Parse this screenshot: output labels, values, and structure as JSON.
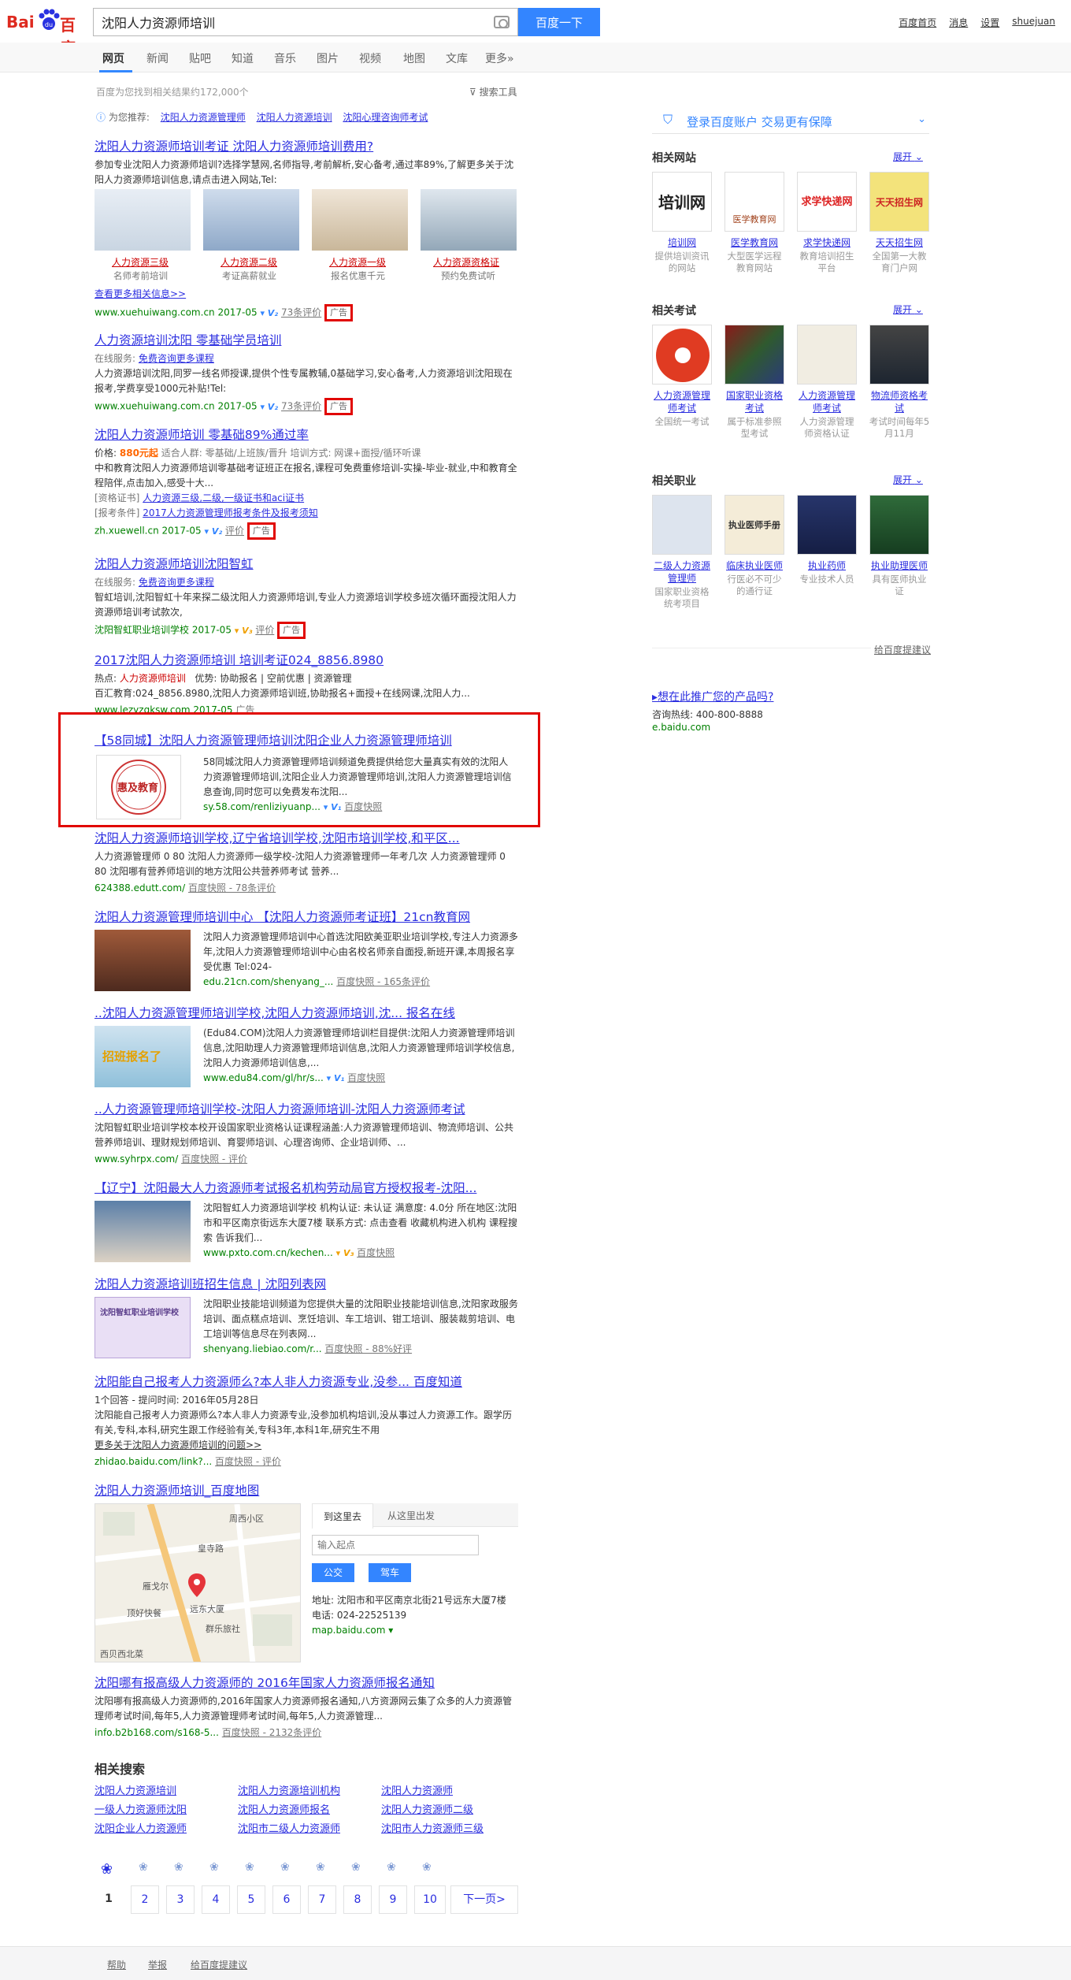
{
  "header": {
    "logo_text": "Bai",
    "logo_text2": "百度",
    "query": "沈阳人力资源师培训",
    "search_btn": "百度一下",
    "links": [
      "百度首页",
      "消息",
      "设置",
      "shuejuan"
    ]
  },
  "tabs": [
    "网页",
    "新闻",
    "贴吧",
    "知道",
    "音乐",
    "图片",
    "视频",
    "地图",
    "文库",
    "更多»"
  ],
  "stats": "百度为您找到相关结果约172,000个",
  "tools": "搜索工具",
  "recommend": {
    "label": "为您推荐:",
    "items": [
      "沈阳人力资源管理师",
      "沈阳人力资源培训",
      "沈阳心理咨询师考试"
    ]
  },
  "results": [
    {
      "title": "沈阳人力资源师培训考证 沈阳人力资源师培训费用?",
      "desc": "参加专业沈阳人力资源师培训?选择学慧网,名师指导,考前解析,安心备考,通过率89%,了解更多关于沈阳人力资源师培训信息,请点击进入网站,Tel:",
      "thumbs": [
        {
          "label": "人力资源三级",
          "sub": "名师考前培训"
        },
        {
          "label": "人力资源二级",
          "sub": "考证高薪就业"
        },
        {
          "label": "人力资源一级",
          "sub": "报名优惠千元"
        },
        {
          "label": "人力资源资格证",
          "sub": "预约免费试听"
        }
      ],
      "more": "查看更多相关信息>>",
      "url": "www.xuehuiwang.com.cn  2017-05",
      "meta": "73条评价",
      "ad": "广告"
    },
    {
      "title": "人力资源培训沈阳 零基础学员培训",
      "service_label": "在线服务:",
      "service": "免费咨询更多课程",
      "desc": "人力资源培训沈阳,同罗一线名师授课,提供个性专属教辅,0基础学习,安心备考,人力资源培训沈阳现在报考,学费享受1000元补贴!Tel:",
      "url": "www.xuehuiwang.com.cn  2017-05",
      "meta": "73条评价",
      "ad": "广告"
    },
    {
      "title": "沈阳人力资源师培训 零基础89%通过率",
      "price_label": "价格:",
      "price": "880元起",
      "info": "适合人群: 零基础/上班族/晋升   培训方式: 网课+面授/循环听课",
      "desc": "中和教育沈阳人力资源师培训零基础考证班正在报名,课程可免费重修培训-实操-毕业-就业,中和教育全程陪伴,点击加入,感受十大...",
      "cert_label": "[资格证书]",
      "cert": "人力资源三级,二级,一级证书和aci证书",
      "cond_label": "[报考条件]",
      "cond": "2017人力资源管理师报考条件及报考须知",
      "url": "zh.xuewell.cn  2017-05",
      "meta": "评价",
      "ad": "广告"
    },
    {
      "title": "沈阳人力资源师培训沈阳智虹",
      "service_label": "在线服务:",
      "service": "免费咨询更多课程",
      "desc": "智虹培训,沈阳智虹十年来探二级沈阳人力资源师培训,专业人力资源培训学校多班次循环面授沈阳人力资源师培训考试款次,",
      "url": "沈阳智虹职业培训学校  2017-05",
      "meta": "评价",
      "ad": "广告"
    },
    {
      "title": "2017沈阳人力资源师培训 培训考证024_8856.8980",
      "hot_label": "热点:",
      "hot": "人力资源师培训",
      "hot2": "优势: 协助报名 | 空前优惠 | 资源管理",
      "desc": "百汇教育:024_8856.8980,沈阳人力资源师培训班,协助报名+面授+在线网课,沈阳人力...",
      "url": "www.lezyzgksw.com  2017-05",
      "meta": "广告"
    },
    {
      "title": "【58同城】沈阳人力资源管理师培训沈阳企业人力资源管理师培训",
      "logo_text": "惠及教育",
      "desc": "58同城沈阳人力资源管理师培训频道免费提供给您大量真实有效的沈阳人力资源管理师培训,沈阳企业人力资源管理师培训,沈阳人力资源管理培训信息查询,同时您可以免费发布沈阳...",
      "url": "sy.58.com/renliziyuanp...",
      "meta": "百度快照"
    },
    {
      "title": "沈阳人力资源师培训学校,辽宁省培训学校,沈阳市培训学校,和平区...",
      "desc": "人力资源管理师 0 80 沈阳人力资源师一级学校-沈阳人力资源管理师一年考几次 人力资源管理师 0 80 沈阳哪有营养师培训的地方沈阳公共营养师考试 营养...",
      "url": "624388.edutt.com/",
      "meta": "百度快照 - 78条评价"
    },
    {
      "title": "沈阳人力资源管理师培训中心 【沈阳人力资源师考证班】21cn教育网",
      "desc": "沈阳人力资源管理师培训中心首选沈阳欧美亚职业培训学校,专注人力资源多年,沈阳人力资源管理师培训中心由名校名师亲自面授,新班开课,本周报名享受优惠 Tel:024-",
      "url": "edu.21cn.com/shenyang_...",
      "meta": "百度快照 - 165条评价"
    },
    {
      "title": "..沈阳人力资源管理师培训学校,沈阳人力资源师培训,沈... 报名在线",
      "img_text": "招班报名了",
      "desc": "(Edu84.COM)沈阳人力资源管理师培训栏目提供:沈阳人力资源管理师培训信息,沈阳助理人力资源管理师培训信息,沈阳人力资源管理师培训学校信息,沈阳人力资源师培训信息,...",
      "url": "www.edu84.com/gl/hr/s...",
      "meta": "百度快照"
    },
    {
      "title": "..人力资源管理师培训学校-沈阳人力资源师培训-沈阳人力资源师考试",
      "desc": "沈阳智虹职业培训学校本校开设国家职业资格认证课程涵盖:人力资源管理师培训、物流师培训、公共营养师培训、理财规划师培训、育婴师培训、心理咨询师、企业培训师、...",
      "url": "www.syhrpx.com/",
      "meta": "百度快照 - 评价"
    },
    {
      "title": "【辽宁】沈阳最大人力资源师考试报名机构劳动局官方授权报考-沈阳...",
      "desc": "沈阳智虹人力资源培训学校 机构认证: 未认证 满意度: 4.0分 所在地区:沈阳市和平区南京街远东大厦7楼 联系方式: 点击查看 收藏机构进入机构 课程搜索 告诉我们...",
      "url": "www.pxto.com.cn/kechen...",
      "meta": "百度快照"
    },
    {
      "title": "沈阳人力资源培训班招生信息 | 沈阳列表网",
      "img_text": "沈阳智虹职业培训学校",
      "desc": "沈阳职业技能培训频道为您提供大量的沈阳职业技能培训信息,沈阳家政服务培训、面点糕点培训、烹饪培训、车工培训、钳工培训、服装裁剪培训、电工培训等信息尽在列表网...",
      "url": "shenyang.liebiao.com/r...",
      "meta": "百度快照 - 88%好评"
    },
    {
      "title": "沈阳能自己报考人力资源师么?本人非人力资源专业,没参... 百度知道",
      "answers": "1个回答 - 提问时间: 2016年05月28日",
      "desc": "沈阳能自己报考人力资源师么?本人非人力资源专业,没参加机构培训,没从事过人力资源工作。跟学历有关,专科,本科,研究生跟工作经验有关,专科3年,本科1年,研究生不用",
      "more": "更多关于沈阳人力资源师培训的问题>>",
      "url": "zhidao.baidu.com/link?...",
      "meta": "百度快照 - 评价"
    },
    {
      "title": "沈阳人力资源师培训_百度地图",
      "map_tabs": [
        "到这里去",
        "从这里出发"
      ],
      "input_placeholder": "输入起点",
      "btn_bus": "公交",
      "btn_drive": "驾车",
      "addr_label": "地址:",
      "addr": "沈阳市和平区南京北街21号远东大厦7楼",
      "tel_label": "电话:",
      "tel": "024-22525139",
      "url": "map.baidu.com",
      "map_labels": [
        "周西小区",
        "皇寺路",
        "雁戈尔",
        "顶好快餐",
        "远东大厦",
        "群乐旅社",
        "西贝西北菜"
      ]
    },
    {
      "title": "沈阳哪有报高级人力资源师的 2016年国家人力资源师报名通知",
      "desc": "沈阳哪有报高级人力资源师的,2016年国家人力资源师报名通知,八方资源网云集了众多的人力资源管理师考试时间,每年5,人力资源管理师考试时间,每年5,人力资源管理...",
      "url": "info.b2b168.com/s168-5...",
      "meta": "百度快照 - 2132条评价"
    }
  ],
  "related": {
    "title": "相关搜索",
    "items": [
      "沈阳人力资源培训",
      "沈阳人力资源培训机构",
      "沈阳人力资源师",
      "一级人力资源师沈阳",
      "沈阳人力资源师报名",
      "沈阳人力资源师二级",
      "沈阳企业人力资源师",
      "沈阳市二级人力资源师",
      "沈阳市人力资源师三级"
    ]
  },
  "pagination": [
    "1",
    "2",
    "3",
    "4",
    "5",
    "6",
    "7",
    "8",
    "9",
    "10",
    "下一页>"
  ],
  "footer": [
    "帮助",
    "举报",
    "给百度提建议"
  ],
  "right": {
    "login": "登录百度账户  交易更有保障",
    "sites_title": "相关网站",
    "expand": "展开",
    "sites": [
      {
        "img": "培训网",
        "name": "培训网",
        "desc": "提供培训资讯的网站"
      },
      {
        "img": "医学教育网",
        "name": "医学教育网",
        "desc": "大型医学远程教育网站"
      },
      {
        "img": "求学快递网",
        "name": "求学快递网",
        "desc": "教育培训招生平台"
      },
      {
        "img": "天天招生网",
        "name": "天天招生网",
        "desc": "全国第一大教育门户网"
      }
    ],
    "exams_title": "相关考试",
    "exams": [
      {
        "name": "人力资源管理师考试",
        "desc": "全国统一考试"
      },
      {
        "name": "国家职业资格考试",
        "desc": "属于标准参照型考试"
      },
      {
        "name": "人力资源管理师考试",
        "desc": "人力资源管理师资格认证"
      },
      {
        "name": "物流师资格考试",
        "desc": "考试时间每年5月11月"
      }
    ],
    "jobs_title": "相关职业",
    "jobs": [
      {
        "name": "二级人力资源管理师",
        "desc": "国家职业资格统考项目"
      },
      {
        "img": "执业医师手册",
        "name": "临床执业医师",
        "desc": "行医必不可少的通行证"
      },
      {
        "name": "执业药师",
        "desc": "专业技术人员"
      },
      {
        "name": "执业助理医师",
        "desc": "具有医师执业证"
      }
    ],
    "feedback": "给百度提建议",
    "promo": "▸想在此推广您的产品吗?",
    "promo_tel": "咨询热线: 400-800-8888",
    "promo_url": "e.baidu.com"
  },
  "colors": {
    "brand_blue": "#3385ff",
    "link": "#2b2ee0",
    "em": "#cc0000",
    "url": "#008000",
    "ad_box": "#e10601"
  }
}
